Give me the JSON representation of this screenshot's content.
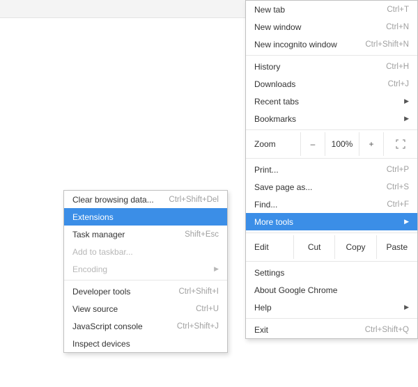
{
  "main_menu": {
    "new_tab": {
      "label": "New tab",
      "shortcut": "Ctrl+T"
    },
    "new_window": {
      "label": "New window",
      "shortcut": "Ctrl+N"
    },
    "new_incognito": {
      "label": "New incognito window",
      "shortcut": "Ctrl+Shift+N"
    },
    "history": {
      "label": "History",
      "shortcut": "Ctrl+H"
    },
    "downloads": {
      "label": "Downloads",
      "shortcut": "Ctrl+J"
    },
    "recent_tabs": {
      "label": "Recent tabs"
    },
    "bookmarks": {
      "label": "Bookmarks"
    },
    "zoom": {
      "label": "Zoom",
      "minus": "–",
      "value": "100%",
      "plus": "+"
    },
    "print": {
      "label": "Print...",
      "shortcut": "Ctrl+P"
    },
    "save_as": {
      "label": "Save page as...",
      "shortcut": "Ctrl+S"
    },
    "find": {
      "label": "Find...",
      "shortcut": "Ctrl+F"
    },
    "more_tools": {
      "label": "More tools"
    },
    "edit": {
      "label": "Edit",
      "cut": "Cut",
      "copy": "Copy",
      "paste": "Paste"
    },
    "settings": {
      "label": "Settings"
    },
    "about": {
      "label": "About Google Chrome"
    },
    "help": {
      "label": "Help"
    },
    "exit": {
      "label": "Exit",
      "shortcut": "Ctrl+Shift+Q"
    }
  },
  "sub_menu": {
    "clear_browsing": {
      "label": "Clear browsing data...",
      "shortcut": "Ctrl+Shift+Del"
    },
    "extensions": {
      "label": "Extensions"
    },
    "task_manager": {
      "label": "Task manager",
      "shortcut": "Shift+Esc"
    },
    "add_taskbar": {
      "label": "Add to taskbar..."
    },
    "encoding": {
      "label": "Encoding"
    },
    "dev_tools": {
      "label": "Developer tools",
      "shortcut": "Ctrl+Shift+I"
    },
    "view_source": {
      "label": "View source",
      "shortcut": "Ctrl+U"
    },
    "js_console": {
      "label": "JavaScript console",
      "shortcut": "Ctrl+Shift+J"
    },
    "inspect_devices": {
      "label": "Inspect devices"
    }
  },
  "colors": {
    "highlight": "#3b8ee7"
  }
}
